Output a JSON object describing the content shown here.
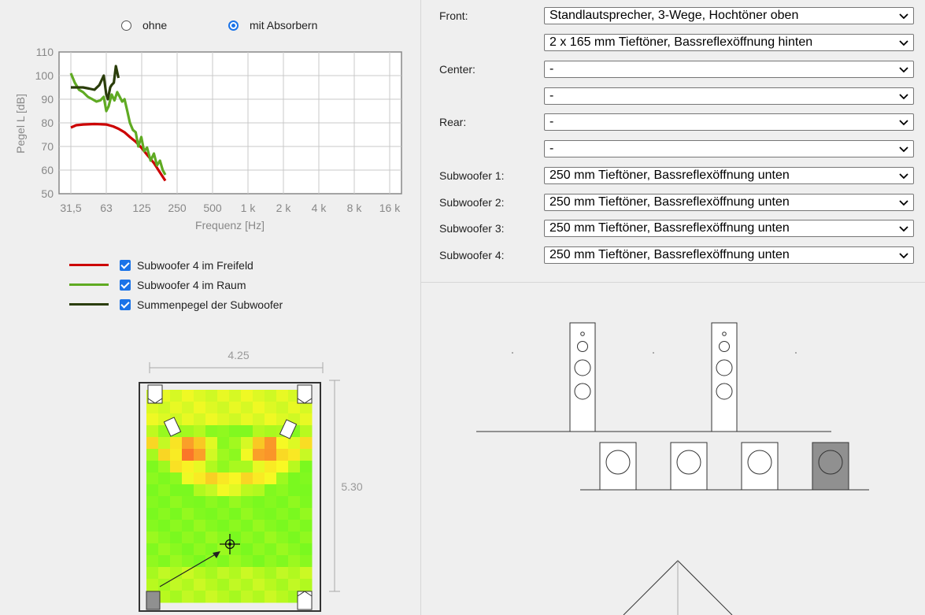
{
  "radio": {
    "option1": "ohne",
    "option2": "mit Absorbern",
    "selected": "mit Absorbern"
  },
  "chart_data": {
    "type": "line",
    "xlabel": "Frequenz [Hz]",
    "ylabel": "Pegel L [dB]",
    "x_scale": "log",
    "x_ticks": [
      "31,5",
      "63",
      "125",
      "250",
      "500",
      "1 k",
      "2 k",
      "4 k",
      "8 k",
      "16 k"
    ],
    "y_ticks": [
      "50",
      "60",
      "70",
      "80",
      "90",
      "100",
      "110"
    ],
    "ylim": [
      50,
      110
    ],
    "grid": true,
    "series": [
      {
        "name": "Subwoofer 4 im Freifeld",
        "color": "#cc0000",
        "x": [
          31.5,
          35,
          40,
          50,
          63,
          72,
          80,
          90,
          100,
          112,
          125,
          140,
          160,
          180,
          200
        ],
        "y": [
          78,
          79,
          79.3,
          79.5,
          79.3,
          78.5,
          77.5,
          76,
          74,
          72,
          69.5,
          66.5,
          63,
          59,
          55.5
        ]
      },
      {
        "name": "Subwoofer 4 im Raum",
        "color": "#5faa22",
        "x": [
          31.5,
          34,
          37,
          40,
          44,
          48,
          52,
          56,
          60,
          63,
          66,
          70,
          74,
          78,
          82,
          86,
          90,
          95,
          100,
          106,
          112,
          118,
          125,
          132,
          140,
          150,
          160,
          170,
          180,
          190,
          200
        ],
        "y": [
          101,
          97,
          94,
          93,
          91,
          90,
          89,
          89.5,
          91,
          85,
          87,
          92,
          89.5,
          93,
          91,
          89,
          90,
          85,
          80,
          77,
          76,
          70,
          74,
          68,
          69.5,
          64,
          67,
          62,
          64,
          60,
          58
        ]
      },
      {
        "name": "Summenpegel der Subwoofer",
        "color": "#2a3d0a",
        "x": [
          31.5,
          35,
          40,
          45,
          50,
          55,
          60,
          63,
          65,
          68,
          70,
          73,
          76,
          80
        ],
        "y": [
          95,
          95,
          95,
          94.5,
          94,
          96,
          100,
          92,
          90,
          95,
          96,
          97,
          104,
          99
        ]
      }
    ]
  },
  "legend": [
    {
      "label": "Subwoofer 4 im Freifeld",
      "color": "#cc0000"
    },
    {
      "label": "Subwoofer 4 im Raum",
      "color": "#5faa22"
    },
    {
      "label": "Summenpegel der Subwoofer",
      "color": "#2a3d0a"
    }
  ],
  "room": {
    "width_label": "4.25",
    "depth_label": "5.30"
  },
  "form": {
    "front_label": "Front:",
    "front_select1": "Standlautsprecher, 3-Wege, Hochtöner oben",
    "front_select2": "2 x 165 mm Tieftöner, Bassreflexöffnung hinten",
    "center_label": "Center:",
    "center_select1": "-",
    "center_select2": "-",
    "rear_label": "Rear:",
    "rear_select1": "-",
    "rear_select2": "-",
    "sub1_label": "Subwoofer 1:",
    "sub1_select": "250 mm Tieftöner, Bassreflexöffnung unten",
    "sub2_label": "Subwoofer 2:",
    "sub2_select": "250 mm Tieftöner, Bassreflexöffnung unten",
    "sub3_label": "Subwoofer 3:",
    "sub3_select": "250 mm Tieftöner, Bassreflexöffnung unten",
    "sub4_label": "Subwoofer 4:",
    "sub4_select": "250 mm Tieftöner, Bassreflexöffnung unten"
  },
  "colors": {
    "accent": "#1a73e8",
    "active_sub": "#909090"
  }
}
